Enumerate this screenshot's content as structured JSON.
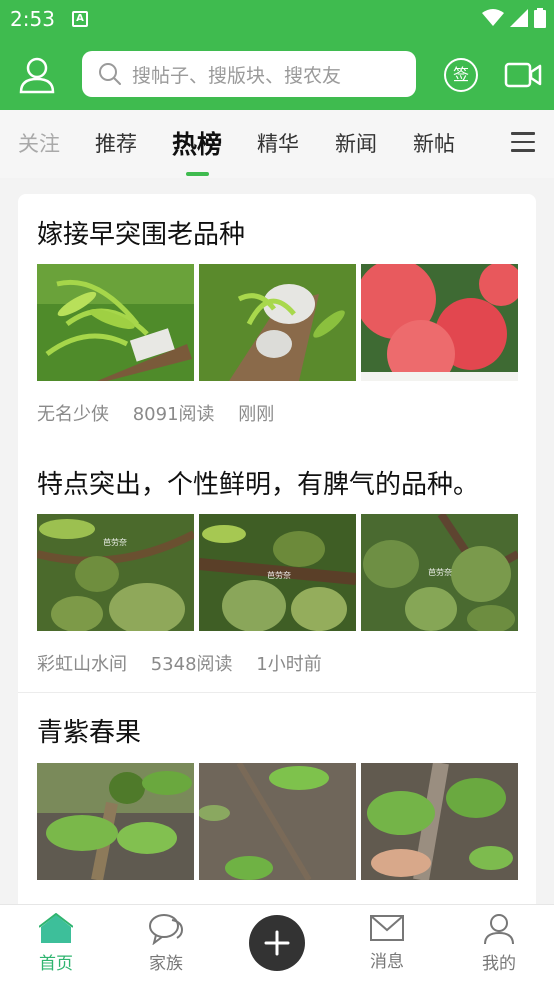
{
  "status_bar": {
    "time": "2:53",
    "notification_badge": "A"
  },
  "header": {
    "search_placeholder": "搜帖子、搜版块、搜农友",
    "sign_in_label": "签",
    "icons": [
      "user-icon",
      "search-icon",
      "video-icon"
    ]
  },
  "tabs": [
    {
      "label": "关注"
    },
    {
      "label": "推荐"
    },
    {
      "label": "热榜"
    },
    {
      "label": "精华"
    },
    {
      "label": "新闻"
    },
    {
      "label": "新帖"
    }
  ],
  "active_tab": "热榜",
  "posts": [
    {
      "title": "嫁接早突围老品种",
      "author": "无名少侠",
      "reads": "8091阅读",
      "time": "刚刚"
    },
    {
      "title": "特点突出，个性鲜明，有脾气的品种。",
      "author": "彩虹山水间",
      "reads": "5348阅读",
      "time": "1小时前",
      "watermark": "芭劳奈"
    },
    {
      "title": "青紫春果",
      "author": "",
      "reads": "",
      "time": ""
    }
  ],
  "bottom_nav": [
    {
      "label": "首页",
      "active": true
    },
    {
      "label": "家族",
      "active": false
    },
    {
      "label": "消息",
      "active": false
    },
    {
      "label": "我的",
      "active": false
    }
  ],
  "colors": {
    "brand_green": "#3fbb4f",
    "active_nav": "#2fb46f",
    "fab": "#333333"
  }
}
